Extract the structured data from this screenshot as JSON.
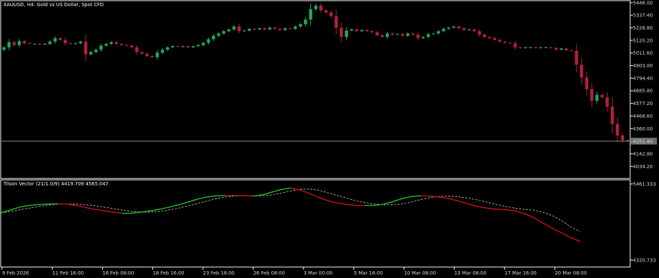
{
  "colors": {
    "background": "#000000",
    "frame": "#ffffff",
    "bull_candle": "#26a65b",
    "bear_candle": "#b3213a",
    "price_line": "#8a8a8a",
    "price_tag_bg": "#6e6e6e",
    "tilson_up": "#22c31e",
    "tilson_down": "#d0101a",
    "tilson_signal": "#a8a8a8"
  },
  "chart_data": [
    {
      "type": "candlestick",
      "title": "XAUUSD, H4:  Gold vs US Dollar, Spot CFD",
      "ylim": [
        4030,
        5445
      ],
      "ytick_labels": [
        "5446.00",
        "5337.40",
        "5228.80",
        "5120.20",
        "5011.60",
        "4903.00",
        "4794.40",
        "4685.80",
        "4577.20",
        "4468.60",
        "4360.00",
        "4251.40",
        "4142.80",
        "4034.20"
      ],
      "current_price": 4251.4,
      "current_price_label": "4251.40",
      "candle_closes": [
        5060,
        5105,
        5080,
        5115,
        5095,
        5090,
        5090,
        5085,
        5090,
        5110,
        5140,
        5125,
        5095,
        5090,
        5095,
        5110,
        5000,
        5020,
        5040,
        5075,
        5090,
        5105,
        5090,
        5080,
        5075,
        5060,
        5020,
        5005,
        4985,
        4975,
        5015,
        5040,
        5060,
        5070,
        5065,
        5070,
        5060,
        5070,
        5080,
        5100,
        5130,
        5160,
        5180,
        5200,
        5215,
        5240,
        5200,
        5205,
        5220,
        5215,
        5225,
        5215,
        5230,
        5220,
        5210,
        5225,
        5220,
        5240,
        5260,
        5300,
        5390,
        5420,
        5380,
        5360,
        5330,
        5230,
        5150,
        5205,
        5215,
        5200,
        5210,
        5200,
        5190,
        5165,
        5150,
        5180,
        5170,
        5175,
        5160,
        5180,
        5170,
        5140,
        5150,
        5175,
        5180,
        5200,
        5220,
        5230,
        5240,
        5225,
        5210,
        5215,
        5200,
        5170,
        5150,
        5140,
        5125,
        5110,
        5100,
        5095,
        5060,
        5055,
        5060,
        5060,
        5055,
        5060,
        5060,
        5055,
        5040,
        5050,
        5035,
        5030,
        4910,
        4800,
        4700,
        4600,
        4650,
        4630,
        4550,
        4400,
        4300,
        4260,
        4251
      ],
      "x_labels": [
        "9 Feb 2026",
        "11 Feb 16:00",
        "16 Feb 08:00",
        "18 Feb 16:00",
        "23 Feb 16:00",
        "26 Feb 08:00",
        "3 Mar 00:00",
        "5 Mar 16:00",
        "10 Mar 08:00",
        "13 Mar 08:00",
        "17 Mar 16:00",
        "20 Mar 08:00"
      ]
    },
    {
      "type": "line",
      "title": "Tilson Vector (21/1.0/9) 4419.709 4565.047",
      "ylim": [
        4320.733,
        5461.333
      ],
      "ytick_labels": [
        "5461.333",
        "4320.733"
      ],
      "series": [
        {
          "values": [
            5030,
            5075,
            5115,
            5140,
            5155,
            5160,
            5162,
            5160,
            5140,
            5110,
            5080,
            5060,
            5040,
            5020,
            5025,
            5040,
            5060,
            5085,
            5115,
            5150,
            5190,
            5235,
            5265,
            5285,
            5290,
            5288,
            5285,
            5280,
            5300,
            5340,
            5380,
            5400,
            5370,
            5320,
            5260,
            5210,
            5175,
            5155,
            5140,
            5138,
            5140,
            5160,
            5200,
            5245,
            5275,
            5285,
            5280,
            5265,
            5240,
            5205,
            5165,
            5125,
            5100,
            5085,
            5075,
            5060,
            5020,
            4960,
            4880,
            4800,
            4730,
            4660,
            4600
          ]
        },
        {
          "values": [
            5030,
            5050,
            5075,
            5100,
            5125,
            5145,
            5157,
            5162,
            5160,
            5150,
            5135,
            5115,
            5092,
            5068,
            5050,
            5040,
            5040,
            5052,
            5073,
            5100,
            5135,
            5170,
            5205,
            5240,
            5266,
            5280,
            5285,
            5285,
            5285,
            5298,
            5325,
            5358,
            5383,
            5388,
            5367,
            5330,
            5290,
            5250,
            5210,
            5180,
            5160,
            5150,
            5150,
            5165,
            5195,
            5230,
            5260,
            5275,
            5278,
            5270,
            5250,
            5223,
            5190,
            5155,
            5125,
            5100,
            5082,
            5070,
            5040,
            4990,
            4915,
            4820,
            4750
          ]
        }
      ]
    }
  ]
}
